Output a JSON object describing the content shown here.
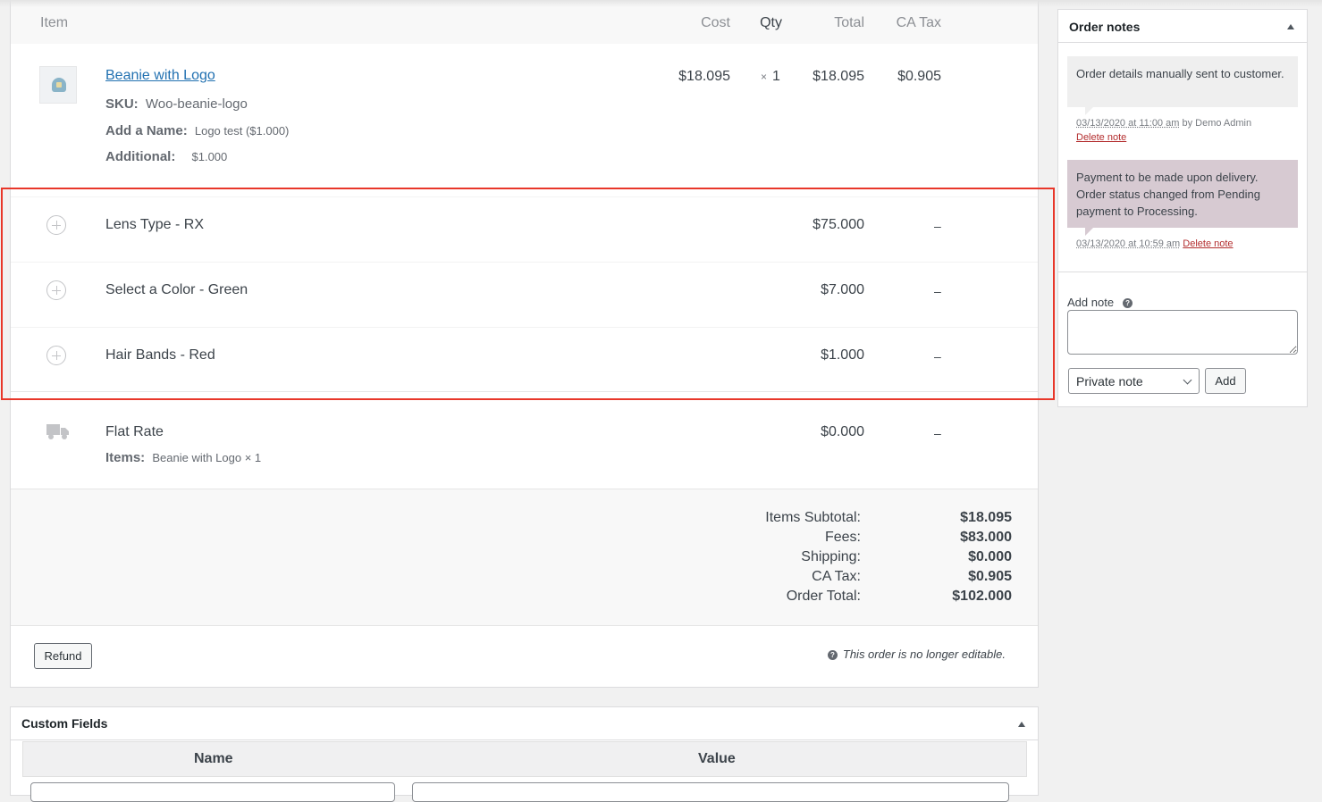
{
  "items_table": {
    "headers": {
      "item": "Item",
      "cost": "Cost",
      "qty": "Qty",
      "total": "Total",
      "tax": "CA Tax"
    },
    "product": {
      "name": "Beanie with Logo",
      "sku_label": "SKU:",
      "sku": "Woo-beanie-logo",
      "meta": [
        {
          "key": "Add a Name:",
          "value": "Logo test ($1.000)"
        },
        {
          "key": "Additional:",
          "value": "$1.000"
        }
      ],
      "cost": "$18.095",
      "qty_symbol": "×",
      "qty": "1",
      "total": "$18.095",
      "tax": "$0.905",
      "thumbnail_icon": "beanie-product-thumbnail"
    },
    "fees": [
      {
        "name": "Lens Type - RX",
        "total": "$75.000",
        "tax": "–"
      },
      {
        "name": "Select a Color - Green",
        "total": "$7.000",
        "tax": "–"
      },
      {
        "name": "Hair Bands - Red",
        "total": "$1.000",
        "tax": "–"
      }
    ],
    "shipping": {
      "name": "Flat Rate",
      "items_label": "Items:",
      "items_value": "Beanie with Logo × 1",
      "total": "$0.000",
      "tax": "–"
    },
    "totals": [
      {
        "label": "Items Subtotal:",
        "value": "$18.095"
      },
      {
        "label": "Fees:",
        "value": "$83.000"
      },
      {
        "label": "Shipping:",
        "value": "$0.000"
      },
      {
        "label": "CA Tax:",
        "value": "$0.905"
      },
      {
        "label": "Order Total:",
        "value": "$102.000"
      }
    ],
    "refund_label": "Refund",
    "not_editable_text": "This order is no longer editable.",
    "help_glyph": "?"
  },
  "custom_fields": {
    "title": "Custom Fields",
    "col_name": "Name",
    "col_value": "Value"
  },
  "order_notes": {
    "title": "Order notes",
    "notes": [
      {
        "content": "Order details manually sent to customer.",
        "date": "03/13/2020 at 11:00 am",
        "by": "by Demo Admin",
        "delete": "Delete note",
        "style": "grey"
      },
      {
        "content": "Payment to be made upon delivery. Order status changed from Pending payment to Processing.",
        "date": "03/13/2020 at 10:59 am",
        "delete": "Delete note",
        "style": "purple"
      }
    ],
    "add_label": "Add note",
    "note_type_selected": "Private note",
    "add_button": "Add"
  },
  "colors": {
    "link": "#2271b1",
    "delete_link": "#b32d2e",
    "highlight_border": "#e8372a",
    "customer_note_bg": "#d7cad2",
    "system_note_bg": "#efefef"
  }
}
